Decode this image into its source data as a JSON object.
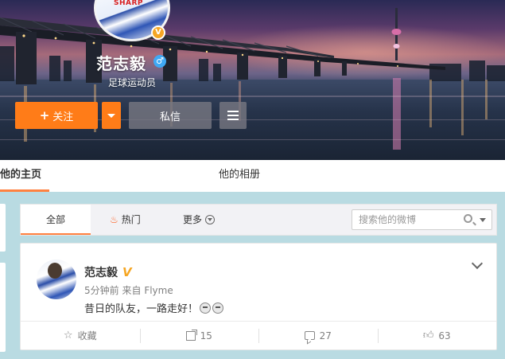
{
  "profile": {
    "name": "范志毅",
    "description": "足球运动员",
    "verified_mark": "V",
    "gender_icon": "male-icon",
    "avatar_brand": "SHARP",
    "follow_label": "关注",
    "message_label": "私信"
  },
  "profile_tabs": [
    {
      "label": "他的主页",
      "active": true
    },
    {
      "label": "他的相册",
      "active": false
    }
  ],
  "feed_filter": {
    "tabs": [
      {
        "label": "全部",
        "active": true
      },
      {
        "label": "热门",
        "icon": "fire-icon"
      },
      {
        "label": "更多",
        "icon": "chevron-down-icon"
      }
    ],
    "search_placeholder": "搜索他的微博"
  },
  "post": {
    "author": "范志毅",
    "time": "5分钟前",
    "source_prefix": "来自",
    "source": "Flyme",
    "text": "昔日的队友，一路走好！",
    "actions": {
      "favorite_label": "收藏",
      "repost_count": "15",
      "comment_count": "27",
      "like_count": "63"
    }
  },
  "colors": {
    "accent_orange": "#ff7c18",
    "tab_underline": "#ff8140",
    "verified_gold": "#f5a623",
    "page_bg": "#b9dbe2"
  }
}
